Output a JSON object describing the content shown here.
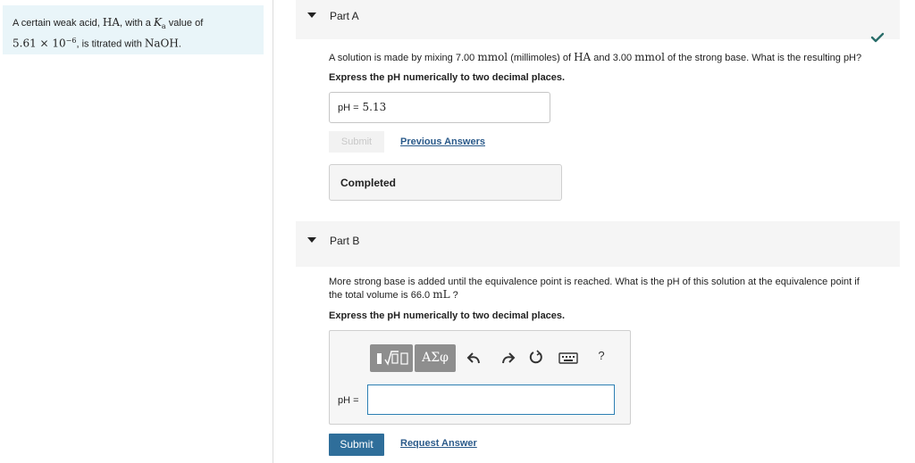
{
  "intro": {
    "p1": "A certain weak acid, ",
    "acid": "HA",
    "p2": ", with a ",
    "ka": "K",
    "ka_sub": "a",
    "p3": " value of",
    "ka_value_base": "5.61 × 10",
    "ka_value_exp": "−6",
    "p4": ", is titrated with ",
    "base": "NaOH",
    "p5": "."
  },
  "part_a": {
    "title": "Part A",
    "question": {
      "t1": "A solution is made by mixing 7.00 ",
      "u1": "mmol",
      "t2": " (millimoles) of ",
      "u2": "HA",
      "t3": " and 3.00 ",
      "u3": "mmol",
      "t4": " of the strong base. What is the resulting pH?"
    },
    "instruction": "Express the pH numerically to two decimal places.",
    "answer_label": "pH =",
    "answer_value": "5.13",
    "submit_label": "Submit",
    "previous_answers_label": "Previous Answers",
    "completed_label": "Completed",
    "status_icon": "checkmark-icon",
    "check_color": "#2a6e6a"
  },
  "part_b": {
    "title": "Part B",
    "question": {
      "t1": "More strong base is added until the equivalence point is reached. What is the pH of this solution at the equivalence point if",
      "t2": "the total volume is 66.0 ",
      "u1": "mL",
      "t3": " ?"
    },
    "instruction": "Express the pH numerically to two decimal places.",
    "toolbar": {
      "greek_label": "ΑΣφ",
      "help_label": "?",
      "icons": [
        "templates-icon",
        "greek-symbols-icon",
        "undo-icon",
        "redo-icon",
        "reset-icon",
        "keyboard-icon",
        "help-icon"
      ]
    },
    "answer_label": "pH =",
    "answer_value": "",
    "submit_label": "Submit",
    "request_answer_label": "Request Answer",
    "submit_color": "#2f6e9a"
  }
}
